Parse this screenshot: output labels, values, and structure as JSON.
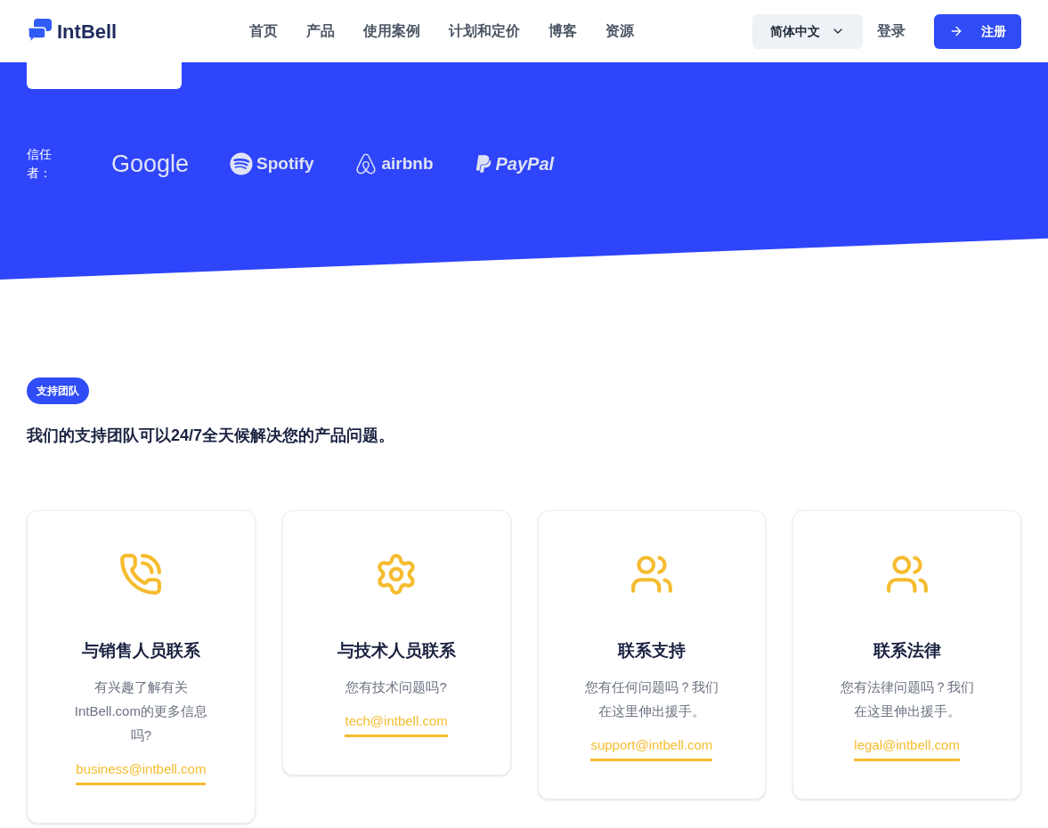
{
  "header": {
    "logo": "IntBell",
    "nav": [
      "首页",
      "产品",
      "使用案例",
      "计划和定价",
      "博客",
      "资源"
    ],
    "language": "简体中文",
    "login": "登录",
    "signup": "注册"
  },
  "hero": {
    "trusted_label": "信任者：",
    "brands": [
      {
        "kind": "google",
        "name": "Google"
      },
      {
        "kind": "spotify",
        "name": "Spotify"
      },
      {
        "kind": "airbnb",
        "name": "airbnb"
      },
      {
        "kind": "paypal",
        "name": "PayPal"
      }
    ]
  },
  "support": {
    "badge": "支持团队",
    "heading": "我们的支持团队可以24/7全天候解决您的产品问题。",
    "cards": [
      {
        "kind": "phone",
        "title": "与销售人员联系",
        "text": "有兴趣了解有关IntBell.com的更多信息吗?",
        "email": "business@intbell.com"
      },
      {
        "kind": "gear",
        "title": "与技术人员联系",
        "text": "您有技术问题吗?",
        "email": "tech@intbell.com"
      },
      {
        "kind": "users",
        "title": "联系支持",
        "text": "您有任何问题吗？我们在这里伸出援手。",
        "email": "support@intbell.com"
      },
      {
        "kind": "users",
        "title": "联系法律",
        "text": "您有法律问题吗？我们在这里伸出援手。",
        "email": "legal@intbell.com"
      }
    ]
  }
}
